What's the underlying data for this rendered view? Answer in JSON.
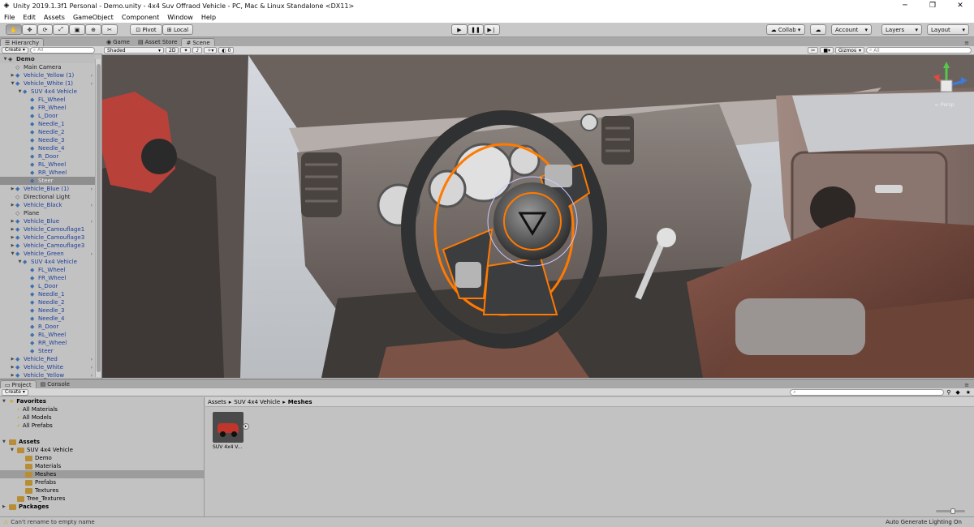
{
  "window": {
    "title": "Unity 2019.1.3f1 Personal - Demo.unity - 4x4 Suv Offraod Vehicle - PC, Mac & Linux Standalone <DX11>"
  },
  "menu": [
    "File",
    "Edit",
    "Assets",
    "GameObject",
    "Component",
    "Window",
    "Help"
  ],
  "toolbar": {
    "pivot": "Pivot",
    "local": "Local",
    "collab": "Collab ▾",
    "account": "Account",
    "layers": "Layers",
    "layout": "Layout"
  },
  "hierarchy": {
    "tab": "Hierarchy",
    "create": "Create",
    "search_placeholder": "All",
    "scene": "Demo",
    "rows": [
      {
        "label": "Main Camera",
        "depth": 1,
        "arrow": "",
        "type": "normal"
      },
      {
        "label": "Vehicle_Yellow (1)",
        "depth": 1,
        "arrow": "▶",
        "type": "prefab",
        "more": true
      },
      {
        "label": "Vehicle_White (1)",
        "depth": 1,
        "arrow": "▼",
        "type": "prefab",
        "more": true
      },
      {
        "label": "SUV 4x4 Vehicle",
        "depth": 2,
        "arrow": "▼",
        "type": "prefab"
      },
      {
        "label": "FL_Wheel",
        "depth": 3,
        "arrow": "",
        "type": "prefab"
      },
      {
        "label": "FR_Wheel",
        "depth": 3,
        "arrow": "",
        "type": "prefab"
      },
      {
        "label": "L_Door",
        "depth": 3,
        "arrow": "",
        "type": "prefab"
      },
      {
        "label": "Needle_1",
        "depth": 3,
        "arrow": "",
        "type": "prefab"
      },
      {
        "label": "Needle_2",
        "depth": 3,
        "arrow": "",
        "type": "prefab"
      },
      {
        "label": "Needle_3",
        "depth": 3,
        "arrow": "",
        "type": "prefab"
      },
      {
        "label": "Needle_4",
        "depth": 3,
        "arrow": "",
        "type": "prefab"
      },
      {
        "label": "R_Door",
        "depth": 3,
        "arrow": "",
        "type": "prefab"
      },
      {
        "label": "RL_Wheel",
        "depth": 3,
        "arrow": "",
        "type": "prefab"
      },
      {
        "label": "RR_Wheel",
        "depth": 3,
        "arrow": "",
        "type": "prefab"
      },
      {
        "label": "Steer",
        "depth": 3,
        "arrow": "",
        "type": "sel"
      },
      {
        "label": "Vehicle_Blue (1)",
        "depth": 1,
        "arrow": "▶",
        "type": "prefab",
        "more": true
      },
      {
        "label": "Directional Light",
        "depth": 1,
        "arrow": "",
        "type": "normal"
      },
      {
        "label": "Vehicle_Black",
        "depth": 1,
        "arrow": "▶",
        "type": "prefab",
        "more": true
      },
      {
        "label": "Plane",
        "depth": 1,
        "arrow": "",
        "type": "normal"
      },
      {
        "label": "Vehicle_Blue",
        "depth": 1,
        "arrow": "▶",
        "type": "prefab",
        "more": true
      },
      {
        "label": "Vehicle_Camouflage1",
        "depth": 1,
        "arrow": "▶",
        "type": "prefab"
      },
      {
        "label": "Vehicle_Camouflage3",
        "depth": 1,
        "arrow": "▶",
        "type": "prefab"
      },
      {
        "label": "Vehicle_Camouflage3",
        "depth": 1,
        "arrow": "▶",
        "type": "prefab"
      },
      {
        "label": "Vehicle_Green",
        "depth": 1,
        "arrow": "▼",
        "type": "prefab",
        "more": true
      },
      {
        "label": "SUV 4x4 Vehicle",
        "depth": 2,
        "arrow": "▼",
        "type": "prefab"
      },
      {
        "label": "FL_Wheel",
        "depth": 3,
        "arrow": "",
        "type": "prefab"
      },
      {
        "label": "FR_Wheel",
        "depth": 3,
        "arrow": "",
        "type": "prefab"
      },
      {
        "label": "L_Door",
        "depth": 3,
        "arrow": "",
        "type": "prefab"
      },
      {
        "label": "Needle_1",
        "depth": 3,
        "arrow": "",
        "type": "prefab"
      },
      {
        "label": "Needle_2",
        "depth": 3,
        "arrow": "",
        "type": "prefab"
      },
      {
        "label": "Needle_3",
        "depth": 3,
        "arrow": "",
        "type": "prefab"
      },
      {
        "label": "Needle_4",
        "depth": 3,
        "arrow": "",
        "type": "prefab"
      },
      {
        "label": "R_Door",
        "depth": 3,
        "arrow": "",
        "type": "prefab"
      },
      {
        "label": "RL_Wheel",
        "depth": 3,
        "arrow": "",
        "type": "prefab"
      },
      {
        "label": "RR_Wheel",
        "depth": 3,
        "arrow": "",
        "type": "prefab"
      },
      {
        "label": "Steer",
        "depth": 3,
        "arrow": "",
        "type": "prefab"
      },
      {
        "label": "Vehicle_Red",
        "depth": 1,
        "arrow": "▶",
        "type": "prefab",
        "more": true
      },
      {
        "label": "Vehicle_White",
        "depth": 1,
        "arrow": "▶",
        "type": "prefab",
        "more": true
      },
      {
        "label": "Vehicle_Yellow",
        "depth": 1,
        "arrow": "▶",
        "type": "prefab",
        "more": true
      }
    ]
  },
  "scene_tabs": [
    {
      "label": "Game",
      "icon": "gamepad-icon"
    },
    {
      "label": "Asset Store",
      "icon": "store-icon"
    },
    {
      "label": "Scene",
      "icon": "grid-icon"
    }
  ],
  "scene_toolbar": {
    "shading": "Shaded",
    "mode_2d": "2D",
    "fx_count": "0",
    "gizmos": "Gizmos",
    "search_placeholder": "All"
  },
  "scene_view": {
    "gizmo_label": "← Persp"
  },
  "project": {
    "tabs": [
      "Project",
      "Console"
    ],
    "create": "Create",
    "tree": [
      {
        "label": "Favorites",
        "depth": 0,
        "kind": "header"
      },
      {
        "label": "All Materials",
        "depth": 1,
        "kind": "fav"
      },
      {
        "label": "All Models",
        "depth": 1,
        "kind": "fav"
      },
      {
        "label": "All Prefabs",
        "depth": 1,
        "kind": "fav"
      },
      {
        "label": "",
        "depth": 0,
        "kind": "spacer"
      },
      {
        "label": "Assets",
        "depth": 0,
        "kind": "header"
      },
      {
        "label": "SUV 4x4 Vehicle",
        "depth": 1,
        "kind": "folder"
      },
      {
        "label": "Demo",
        "depth": 2,
        "kind": "folder"
      },
      {
        "label": "Materials",
        "depth": 2,
        "kind": "folder"
      },
      {
        "label": "Meshes",
        "depth": 2,
        "kind": "folder-sel"
      },
      {
        "label": "Prefabs",
        "depth": 2,
        "kind": "folder"
      },
      {
        "label": "Textures",
        "depth": 2,
        "kind": "folder"
      },
      {
        "label": "Tree_Textures",
        "depth": 1,
        "kind": "folder"
      },
      {
        "label": "Packages",
        "depth": 0,
        "kind": "header"
      }
    ],
    "breadcrumb": {
      "root": "Assets",
      "middle": "SUV 4x4 Vehicle",
      "current": "Meshes",
      "sep": "▸"
    },
    "asset": {
      "label": "SUV 4x4 V..."
    }
  },
  "status": {
    "message": "Can't rename to empty name",
    "right": "Auto Generate Lighting On"
  },
  "colors": {
    "accent_orange": "#ff7a00",
    "selection": "#8e8e8e",
    "prefab_text": "#1f3f9a"
  }
}
